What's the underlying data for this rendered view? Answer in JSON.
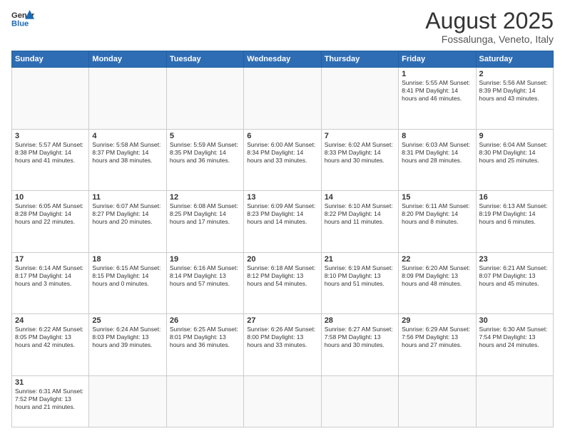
{
  "header": {
    "logo_general": "General",
    "logo_blue": "Blue",
    "month_title": "August 2025",
    "location": "Fossalunga, Veneto, Italy"
  },
  "weekdays": [
    "Sunday",
    "Monday",
    "Tuesday",
    "Wednesday",
    "Thursday",
    "Friday",
    "Saturday"
  ],
  "weeks": [
    [
      {
        "day": "",
        "info": ""
      },
      {
        "day": "",
        "info": ""
      },
      {
        "day": "",
        "info": ""
      },
      {
        "day": "",
        "info": ""
      },
      {
        "day": "",
        "info": ""
      },
      {
        "day": "1",
        "info": "Sunrise: 5:55 AM\nSunset: 8:41 PM\nDaylight: 14 hours and 46 minutes."
      },
      {
        "day": "2",
        "info": "Sunrise: 5:56 AM\nSunset: 8:39 PM\nDaylight: 14 hours and 43 minutes."
      }
    ],
    [
      {
        "day": "3",
        "info": "Sunrise: 5:57 AM\nSunset: 8:38 PM\nDaylight: 14 hours and 41 minutes."
      },
      {
        "day": "4",
        "info": "Sunrise: 5:58 AM\nSunset: 8:37 PM\nDaylight: 14 hours and 38 minutes."
      },
      {
        "day": "5",
        "info": "Sunrise: 5:59 AM\nSunset: 8:35 PM\nDaylight: 14 hours and 36 minutes."
      },
      {
        "day": "6",
        "info": "Sunrise: 6:00 AM\nSunset: 8:34 PM\nDaylight: 14 hours and 33 minutes."
      },
      {
        "day": "7",
        "info": "Sunrise: 6:02 AM\nSunset: 8:33 PM\nDaylight: 14 hours and 30 minutes."
      },
      {
        "day": "8",
        "info": "Sunrise: 6:03 AM\nSunset: 8:31 PM\nDaylight: 14 hours and 28 minutes."
      },
      {
        "day": "9",
        "info": "Sunrise: 6:04 AM\nSunset: 8:30 PM\nDaylight: 14 hours and 25 minutes."
      }
    ],
    [
      {
        "day": "10",
        "info": "Sunrise: 6:05 AM\nSunset: 8:28 PM\nDaylight: 14 hours and 22 minutes."
      },
      {
        "day": "11",
        "info": "Sunrise: 6:07 AM\nSunset: 8:27 PM\nDaylight: 14 hours and 20 minutes."
      },
      {
        "day": "12",
        "info": "Sunrise: 6:08 AM\nSunset: 8:25 PM\nDaylight: 14 hours and 17 minutes."
      },
      {
        "day": "13",
        "info": "Sunrise: 6:09 AM\nSunset: 8:23 PM\nDaylight: 14 hours and 14 minutes."
      },
      {
        "day": "14",
        "info": "Sunrise: 6:10 AM\nSunset: 8:22 PM\nDaylight: 14 hours and 11 minutes."
      },
      {
        "day": "15",
        "info": "Sunrise: 6:11 AM\nSunset: 8:20 PM\nDaylight: 14 hours and 8 minutes."
      },
      {
        "day": "16",
        "info": "Sunrise: 6:13 AM\nSunset: 8:19 PM\nDaylight: 14 hours and 6 minutes."
      }
    ],
    [
      {
        "day": "17",
        "info": "Sunrise: 6:14 AM\nSunset: 8:17 PM\nDaylight: 14 hours and 3 minutes."
      },
      {
        "day": "18",
        "info": "Sunrise: 6:15 AM\nSunset: 8:15 PM\nDaylight: 14 hours and 0 minutes."
      },
      {
        "day": "19",
        "info": "Sunrise: 6:16 AM\nSunset: 8:14 PM\nDaylight: 13 hours and 57 minutes."
      },
      {
        "day": "20",
        "info": "Sunrise: 6:18 AM\nSunset: 8:12 PM\nDaylight: 13 hours and 54 minutes."
      },
      {
        "day": "21",
        "info": "Sunrise: 6:19 AM\nSunset: 8:10 PM\nDaylight: 13 hours and 51 minutes."
      },
      {
        "day": "22",
        "info": "Sunrise: 6:20 AM\nSunset: 8:09 PM\nDaylight: 13 hours and 48 minutes."
      },
      {
        "day": "23",
        "info": "Sunrise: 6:21 AM\nSunset: 8:07 PM\nDaylight: 13 hours and 45 minutes."
      }
    ],
    [
      {
        "day": "24",
        "info": "Sunrise: 6:22 AM\nSunset: 8:05 PM\nDaylight: 13 hours and 42 minutes."
      },
      {
        "day": "25",
        "info": "Sunrise: 6:24 AM\nSunset: 8:03 PM\nDaylight: 13 hours and 39 minutes."
      },
      {
        "day": "26",
        "info": "Sunrise: 6:25 AM\nSunset: 8:01 PM\nDaylight: 13 hours and 36 minutes."
      },
      {
        "day": "27",
        "info": "Sunrise: 6:26 AM\nSunset: 8:00 PM\nDaylight: 13 hours and 33 minutes."
      },
      {
        "day": "28",
        "info": "Sunrise: 6:27 AM\nSunset: 7:58 PM\nDaylight: 13 hours and 30 minutes."
      },
      {
        "day": "29",
        "info": "Sunrise: 6:29 AM\nSunset: 7:56 PM\nDaylight: 13 hours and 27 minutes."
      },
      {
        "day": "30",
        "info": "Sunrise: 6:30 AM\nSunset: 7:54 PM\nDaylight: 13 hours and 24 minutes."
      }
    ],
    [
      {
        "day": "31",
        "info": "Sunrise: 6:31 AM\nSunset: 7:52 PM\nDaylight: 13 hours and 21 minutes."
      },
      {
        "day": "",
        "info": ""
      },
      {
        "day": "",
        "info": ""
      },
      {
        "day": "",
        "info": ""
      },
      {
        "day": "",
        "info": ""
      },
      {
        "day": "",
        "info": ""
      },
      {
        "day": "",
        "info": ""
      }
    ]
  ]
}
